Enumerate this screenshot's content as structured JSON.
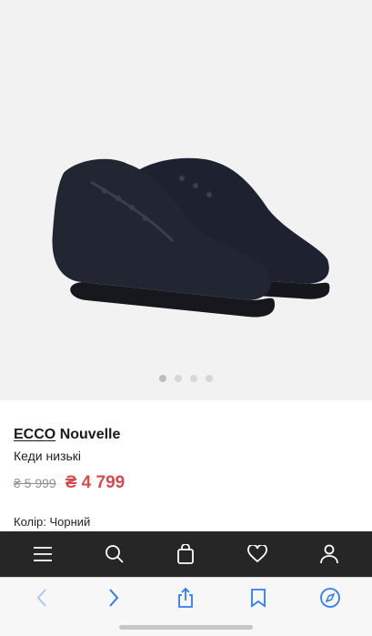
{
  "product": {
    "brand": "ECCO",
    "model": "Nouvelle",
    "subtitle": "Кеди низькі",
    "old_price": "₴ 5 999",
    "new_price": "₴ 4 799",
    "color_label": "Колір: Чорний",
    "image_name": "black low sneakers pair",
    "gallery_count": 4,
    "gallery_active": 0
  },
  "site_nav": {
    "icons": [
      "menu-icon",
      "search-icon",
      "bag-icon",
      "heart-icon",
      "user-icon"
    ],
    "background": "#262626"
  },
  "browser_bar": {
    "icons": [
      "back-icon",
      "forward-icon",
      "share-icon",
      "bookmarks-icon",
      "compass-icon"
    ],
    "accent": "#2f7cf6"
  },
  "colors": {
    "sale_price": "#d64a50",
    "old_price": "#8f8f8f"
  }
}
